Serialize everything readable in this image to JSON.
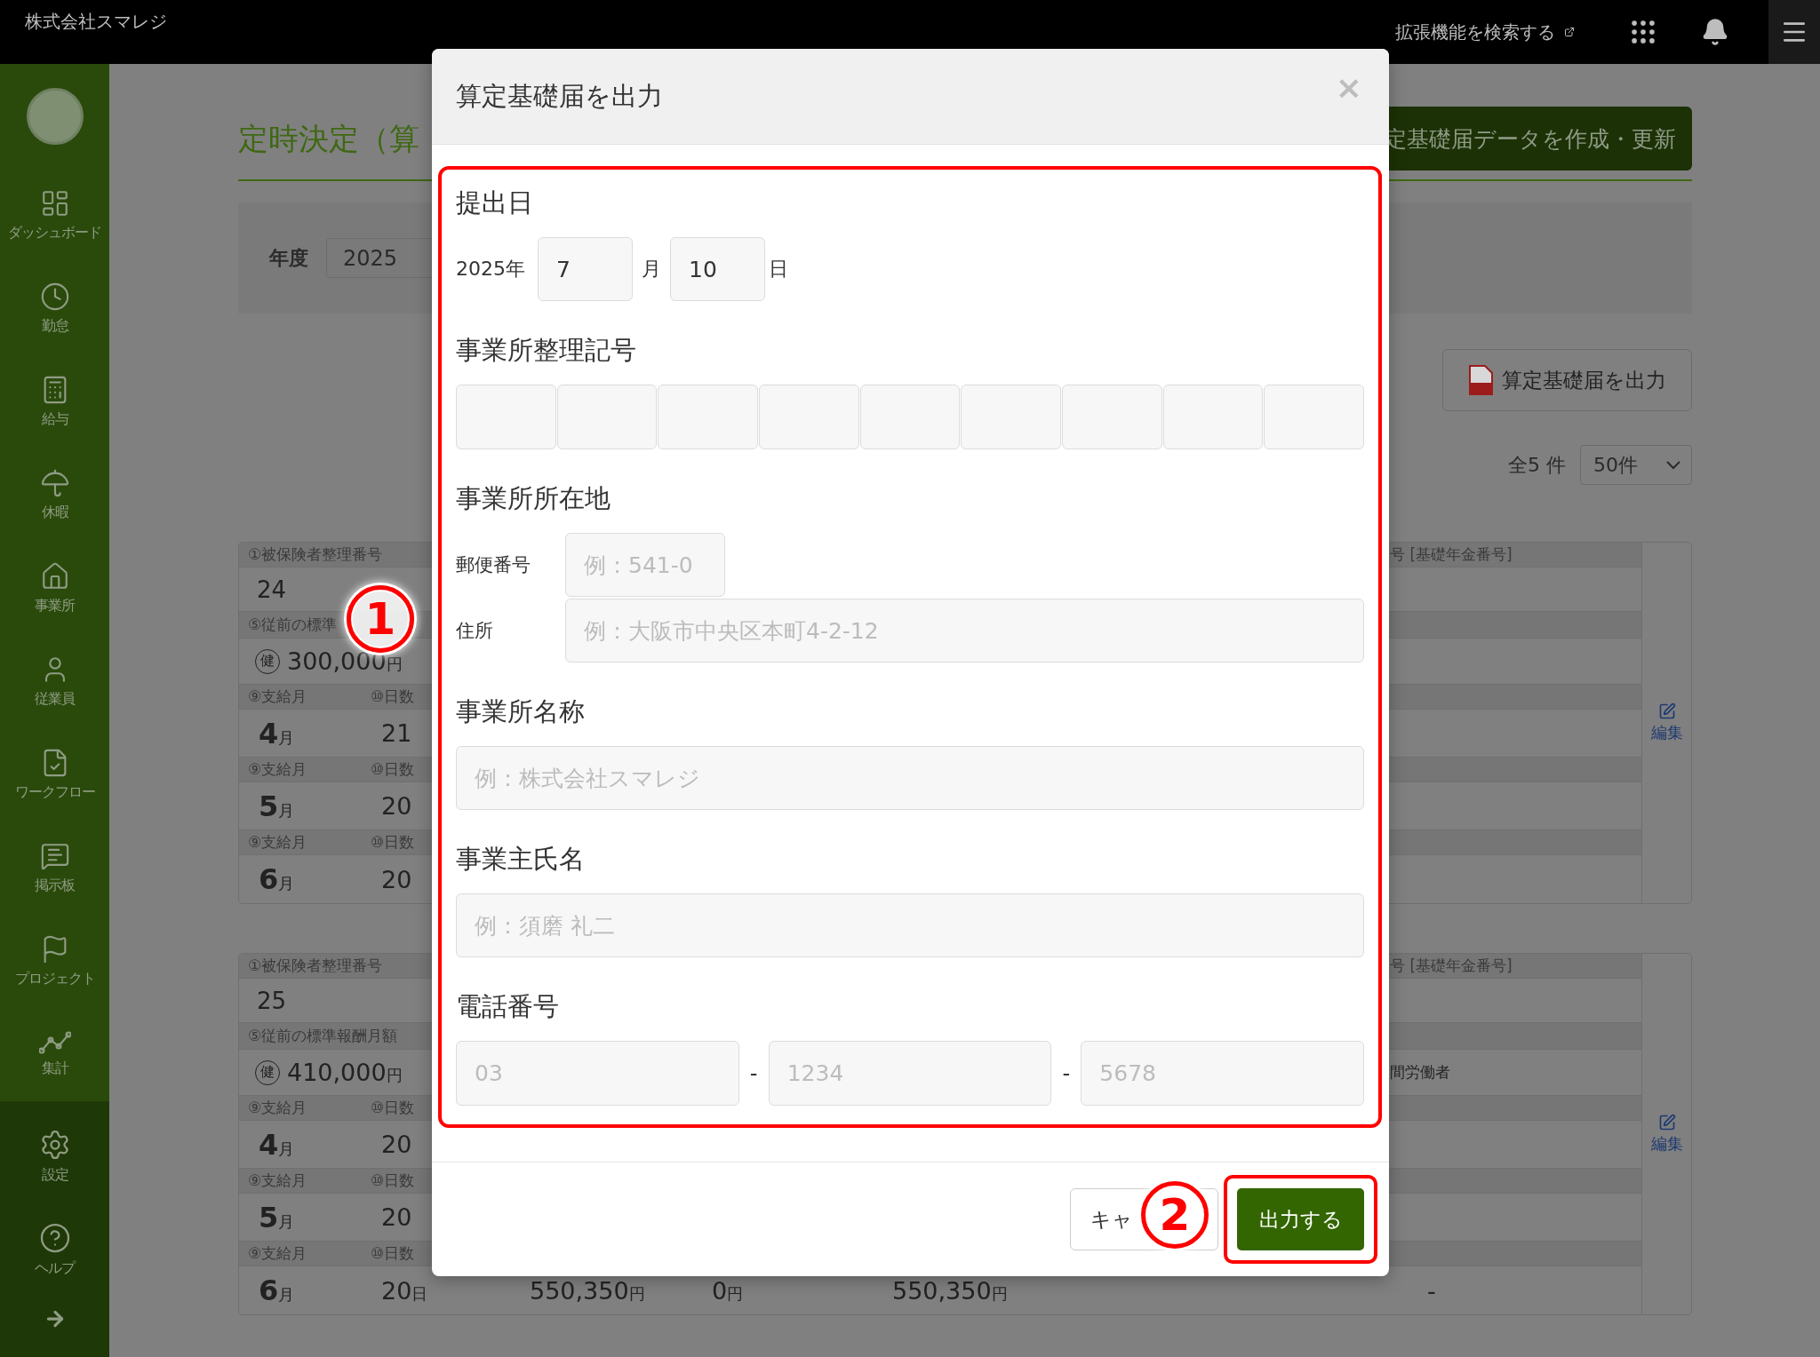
{
  "header": {
    "company": "株式会社スマレジ",
    "extension_link": "拡張機能を検索する"
  },
  "sidebar": {
    "items": [
      {
        "label": "ダッシュボード"
      },
      {
        "label": "勤怠"
      },
      {
        "label": "給与"
      },
      {
        "label": "休暇"
      },
      {
        "label": "事業所"
      },
      {
        "label": "従業員"
      },
      {
        "label": "ワークフロー"
      },
      {
        "label": "掲示板"
      },
      {
        "label": "プロジェクト"
      },
      {
        "label": "集計"
      }
    ],
    "bottom_items": [
      {
        "label": "設定"
      },
      {
        "label": "ヘルプ"
      }
    ]
  },
  "page": {
    "title": "定時決定（算",
    "create_button": "定基礎届データを作成・更新",
    "filter": {
      "label": "年度",
      "year": "2025"
    },
    "export_button": "算定基礎届を出力",
    "total": "全5 件",
    "per_page": "50件"
  },
  "records": [
    {
      "number_label": "①被保険者整理番号",
      "number": "24",
      "pension_label": "号 [基礎年金番号]",
      "prev_label": "⑤従前の標準",
      "health_mark": "健",
      "prev_amount": "300,000",
      "prev_unit": "円",
      "edit": "編集",
      "months": [
        {
          "month_label": "⑨支給月",
          "days_label": "⑩日数",
          "month": "4",
          "month_unit": "月",
          "days": "21"
        },
        {
          "month_label": "⑨支給月",
          "days_label": "⑩日数",
          "month": "5",
          "month_unit": "月",
          "days": "20"
        },
        {
          "month_label": "⑨支給月",
          "days_label": "⑩日数",
          "month": "6",
          "month_unit": "月",
          "days": "20"
        }
      ]
    },
    {
      "number_label": "①被保険者整理番号",
      "number": "25",
      "pension_label": "号 [基礎年金番号]",
      "prev_label": "⑤従前の標準報酬月額",
      "health_mark": "健",
      "prev_amount": "410,000",
      "prev_unit": "円",
      "note": "間労働者",
      "edit": "編集",
      "months": [
        {
          "month_label": "⑨支給月",
          "days_label": "⑩日数",
          "month": "4",
          "month_unit": "月",
          "days": "20"
        },
        {
          "month_label": "⑨支給月",
          "days_label": "⑩日数",
          "month": "5",
          "month_unit": "月",
          "days": "20"
        },
        {
          "month_label": "⑨支給月",
          "days_label": "⑩日数",
          "month": "6",
          "month_unit": "月",
          "days": "20",
          "days_unit": "日",
          "amounts": [
            {
              "value": "550,350",
              "unit": "円"
            },
            {
              "value": "0",
              "unit": "円"
            },
            {
              "value": "550,350",
              "unit": "円"
            }
          ],
          "dash": "-"
        }
      ]
    }
  ],
  "dialog": {
    "title": "算定基礎届を出力",
    "close": "×",
    "submission_date": {
      "title": "提出日",
      "year": "2025年",
      "month": "7",
      "month_unit": "月",
      "day": "10",
      "day_unit": "日"
    },
    "office_code": {
      "title": "事業所整理記号"
    },
    "address": {
      "title": "事業所所在地",
      "postal_label": "郵便番号",
      "postal_placeholder": "例：541-0",
      "address_label": "住所",
      "address_placeholder": "例：大阪市中央区本町4-2-12"
    },
    "office_name": {
      "title": "事業所名称",
      "placeholder": "例：株式会社スマレジ"
    },
    "owner_name": {
      "title": "事業主氏名",
      "placeholder": "例：須磨 礼二"
    },
    "phone": {
      "title": "電話番号",
      "parts": [
        {
          "placeholder": "03"
        },
        {
          "placeholder": "1234"
        },
        {
          "placeholder": "5678"
        }
      ],
      "separators": [
        "-",
        "-"
      ]
    },
    "cancel_button": "キャ",
    "submit_button": "出力する"
  },
  "annotations": [
    {
      "number": "1"
    },
    {
      "number": "2"
    }
  ]
}
